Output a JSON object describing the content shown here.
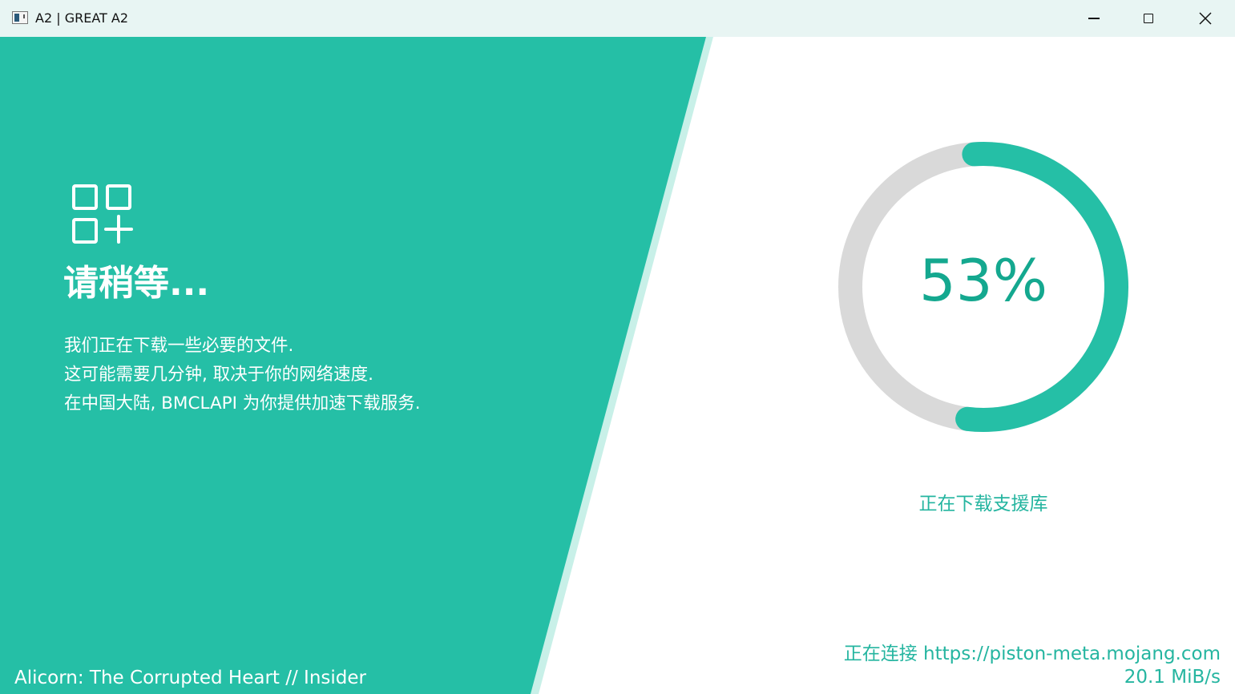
{
  "window": {
    "title": "A2 | GREAT A2",
    "controls": {
      "minimize": "minimize",
      "maximize": "maximize",
      "close": "close"
    }
  },
  "colors": {
    "accent": "#25BFA6",
    "accent_light": "#C8F0E8",
    "track": "#D9D9D9",
    "text_accent": "#14A88F"
  },
  "left": {
    "icon": "apps-add-icon",
    "title": "请稍等...",
    "description": [
      "我们正在下载一些必要的文件.",
      "这可能需要几分钟, 取决于你的网络速度.",
      "在中国大陆, BMCLAPI 为你提供加速下载服务."
    ],
    "footer": "Alicorn: The Corrupted Heart // Insider"
  },
  "progress": {
    "value": 0.53,
    "label": "53%",
    "status": "正在下载支援库"
  },
  "connection": {
    "text": "正在连接 https://piston-meta.mojang.com",
    "speed": "20.1 MiB/s"
  }
}
